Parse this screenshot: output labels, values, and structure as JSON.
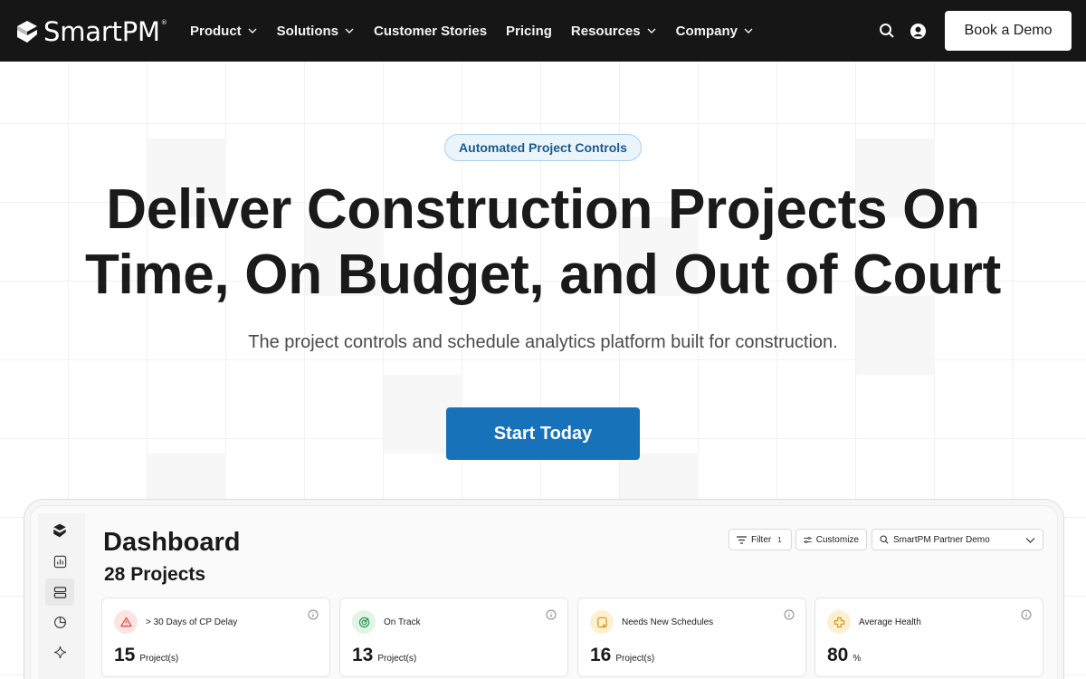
{
  "nav": {
    "logo_text": "SmartPM",
    "logo_mark": "®",
    "links": [
      {
        "label": "Product",
        "has_dropdown": true
      },
      {
        "label": "Solutions",
        "has_dropdown": true
      },
      {
        "label": "Customer Stories",
        "has_dropdown": false
      },
      {
        "label": "Pricing",
        "has_dropdown": false
      },
      {
        "label": "Resources",
        "has_dropdown": true
      },
      {
        "label": "Company",
        "has_dropdown": true
      }
    ],
    "icons": [
      "search-icon",
      "account-icon"
    ],
    "demo_label": "Book a Demo"
  },
  "hero": {
    "badge": "Automated Project Controls",
    "headline_line1": "Deliver Construction Projects On",
    "headline_line2": "Time, On Budget, and Out of Court",
    "subhead": "The project controls and schedule analytics platform built for construction.",
    "cta_label": "Start Today"
  },
  "dashboard": {
    "title": "Dashboard",
    "project_count": "28 Projects",
    "filter_label": "Filter",
    "filter_count": "1",
    "customize_label": "Customize",
    "search_value": "SmartPM Partner Demo",
    "sidebar_icons": [
      "logo-icon",
      "chart-icon",
      "list-icon",
      "pie-icon",
      "sparkle-icon"
    ],
    "cards": [
      {
        "label": "> 30 Days of CP Delay",
        "value": "15",
        "unit": "Project(s)",
        "icon": "warning-icon",
        "color": "#e0463c"
      },
      {
        "label": "On Track",
        "value": "13",
        "unit": "Project(s)",
        "icon": "target-icon",
        "color": "#2f9a55"
      },
      {
        "label": "Needs New Schedules",
        "value": "16",
        "unit": "Project(s)",
        "icon": "schedule-icon",
        "color": "#d59a12"
      },
      {
        "label": "Average Health",
        "value": "80",
        "unit": "%",
        "icon": "health-icon",
        "color": "#d59a12"
      }
    ]
  },
  "colors": {
    "nav_bg": "#161616",
    "accent": "#1872b9",
    "badge_bg": "#eaf4fb",
    "badge_text": "#1c5a88"
  }
}
